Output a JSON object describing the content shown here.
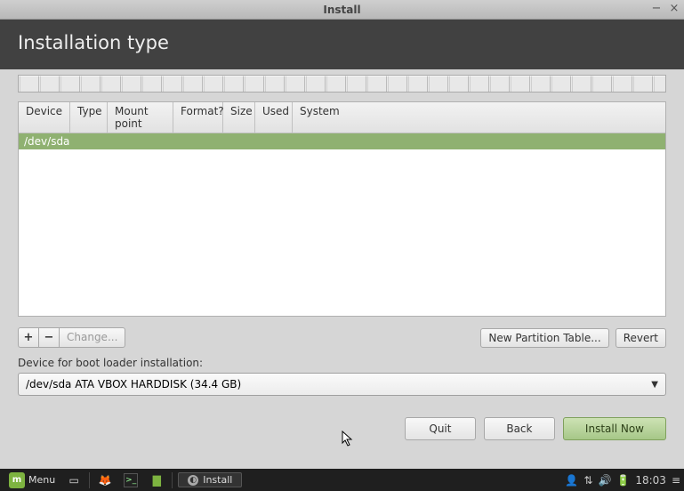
{
  "window": {
    "title": "Install"
  },
  "header": {
    "title": "Installation type"
  },
  "table": {
    "headers": {
      "device": "Device",
      "type": "Type",
      "mount": "Mount point",
      "format": "Format?",
      "size": "Size",
      "used": "Used",
      "system": "System"
    },
    "rows": [
      {
        "device": "/dev/sda"
      }
    ]
  },
  "actions": {
    "add": "+",
    "remove": "−",
    "change": "Change...",
    "new_table": "New Partition Table...",
    "revert": "Revert"
  },
  "boot": {
    "label": "Device for boot loader installation:",
    "selected": "/dev/sda  ATA VBOX HARDDISK (34.4 GB)"
  },
  "footer": {
    "quit": "Quit",
    "back": "Back",
    "install": "Install Now"
  },
  "taskbar": {
    "menu": "Menu",
    "app": "Install",
    "time": "18:03"
  }
}
